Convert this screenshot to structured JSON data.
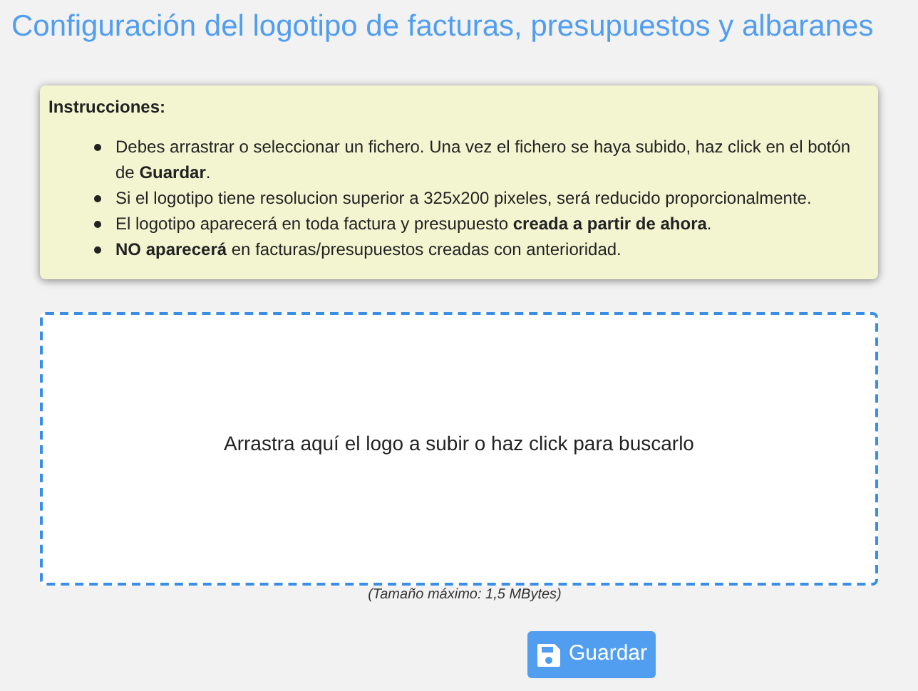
{
  "title": "Configuración del logotipo de facturas, presupuestos y albaranes",
  "instructions": {
    "heading": "Instrucciones:",
    "items": [
      "Debes arrastrar o seleccionar un fichero. Una vez el fichero se haya subido, haz click en el botón de **Guardar**.",
      "Si el logotipo tiene resolucion superior a 325x200 pixeles, será reducido proporcionalmente.",
      "El logotipo aparecerá en toda factura y presupuesto **creada a partir de ahora**.",
      "**NO aparecerá** en facturas/presupuestos creadas con anterioridad."
    ]
  },
  "dropzone": {
    "message": "Arrastra aquí el logo a subir o haz click para buscarlo"
  },
  "max_size_note": "(Tamaño máximo: 1,5 MBytes)",
  "save_button": {
    "label": "Guardar"
  }
}
